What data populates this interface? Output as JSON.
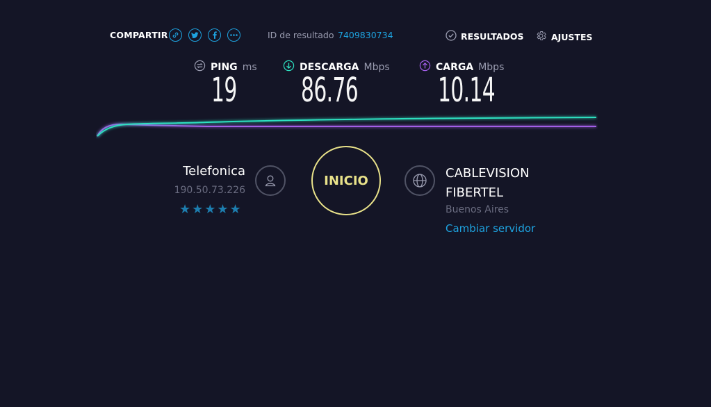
{
  "share": {
    "label": "COMPARTIR",
    "icons": [
      "link-icon",
      "twitter-icon",
      "facebook-icon",
      "more-icon"
    ]
  },
  "result": {
    "label": "ID de resultado",
    "id": "7409830734"
  },
  "nav": {
    "results_label": "RESULTADOS",
    "settings_label": "AJUSTES"
  },
  "metrics": {
    "ping": {
      "label": "PING",
      "unit": "ms",
      "value": "19"
    },
    "download": {
      "label": "DESCARGA",
      "unit": "Mbps",
      "value": "86.76"
    },
    "upload": {
      "label": "CARGA",
      "unit": "Mbps",
      "value": "10.14"
    }
  },
  "isp": {
    "name": "Telefonica",
    "ip": "190.50.73.226",
    "stars": "★★★★★",
    "rating": 5
  },
  "go_button": {
    "label": "INICIO"
  },
  "server": {
    "name_line1": "CABLEVISION",
    "name_line2": "FIBERTEL",
    "location": "Buenos Aires",
    "change_label": "Cambiar servidor"
  },
  "colors": {
    "accent": "#1ea3e0",
    "download": "#2de0c0",
    "upload": "#a35ee8",
    "go": "#e9e28a",
    "background": "#141526"
  }
}
